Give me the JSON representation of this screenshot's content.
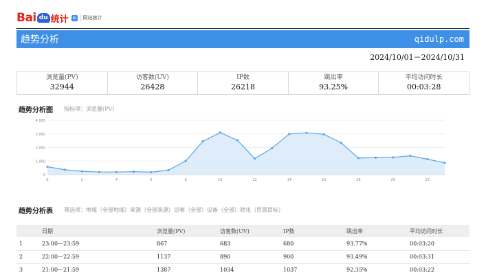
{
  "brand": {
    "bai": "Bai",
    "du": "du",
    "tongji": "统计",
    "badge": "Ai",
    "sub": "网站统计"
  },
  "banner": {
    "title": "趋势分析",
    "domain": "qidulp.com"
  },
  "date_range": "2024/10/01－2024/10/31",
  "kpis": [
    {
      "label": "浏览量(PV)",
      "value": "32944"
    },
    {
      "label": "访客数(UV)",
      "value": "26428"
    },
    {
      "label": "IP数",
      "value": "26218"
    },
    {
      "label": "跳出率",
      "value": "93.25%"
    },
    {
      "label": "平均访问时长",
      "value": "00:03:28"
    }
  ],
  "trend": {
    "title": "趋势分析图",
    "note": "指标项：浏览量(PV)"
  },
  "chart_data": {
    "type": "area",
    "x": [
      0,
      1,
      2,
      3,
      4,
      5,
      6,
      7,
      8,
      9,
      10,
      11,
      12,
      13,
      14,
      15,
      16,
      17,
      18,
      19,
      20,
      21,
      22,
      23
    ],
    "values": [
      580,
      360,
      250,
      190,
      190,
      220,
      180,
      330,
      1000,
      2450,
      3100,
      2530,
      1180,
      1950,
      3000,
      3080,
      2970,
      2350,
      1220,
      1250,
      1270,
      1387,
      1137,
      867
    ],
    "xticks": [
      "0",
      "2",
      "4",
      "6",
      "8",
      "10",
      "12",
      "14",
      "16",
      "18",
      "20",
      "22"
    ],
    "yticks": [
      "0",
      "1,000",
      "2,000",
      "3,000",
      "4,000"
    ],
    "ylim": [
      0,
      4000
    ],
    "xlim": [
      0,
      23
    ],
    "color": "#5aa6e6",
    "fill": "#dbeaf8"
  },
  "table": {
    "title": "趋势分析表",
    "filters": "筛选项：地域（全部地域）来源（全部来源）访客（全部）设备（全部）转化（页面目标）",
    "headers": [
      "",
      "日期",
      "浏览量(PV)",
      "访客数(UV)",
      "IP数",
      "跳出率",
      "平均访问时长"
    ],
    "rows": [
      [
        "1",
        "23:00－23:59",
        "867",
        "683",
        "680",
        "93.77%",
        "00:03:20"
      ],
      [
        "2",
        "22:00－22:59",
        "1137",
        "890",
        "900",
        "93.49%",
        "00:03:31"
      ],
      [
        "3",
        "21:00－21:59",
        "1387",
        "1034",
        "1037",
        "92.35%",
        "00:03:22"
      ]
    ]
  }
}
